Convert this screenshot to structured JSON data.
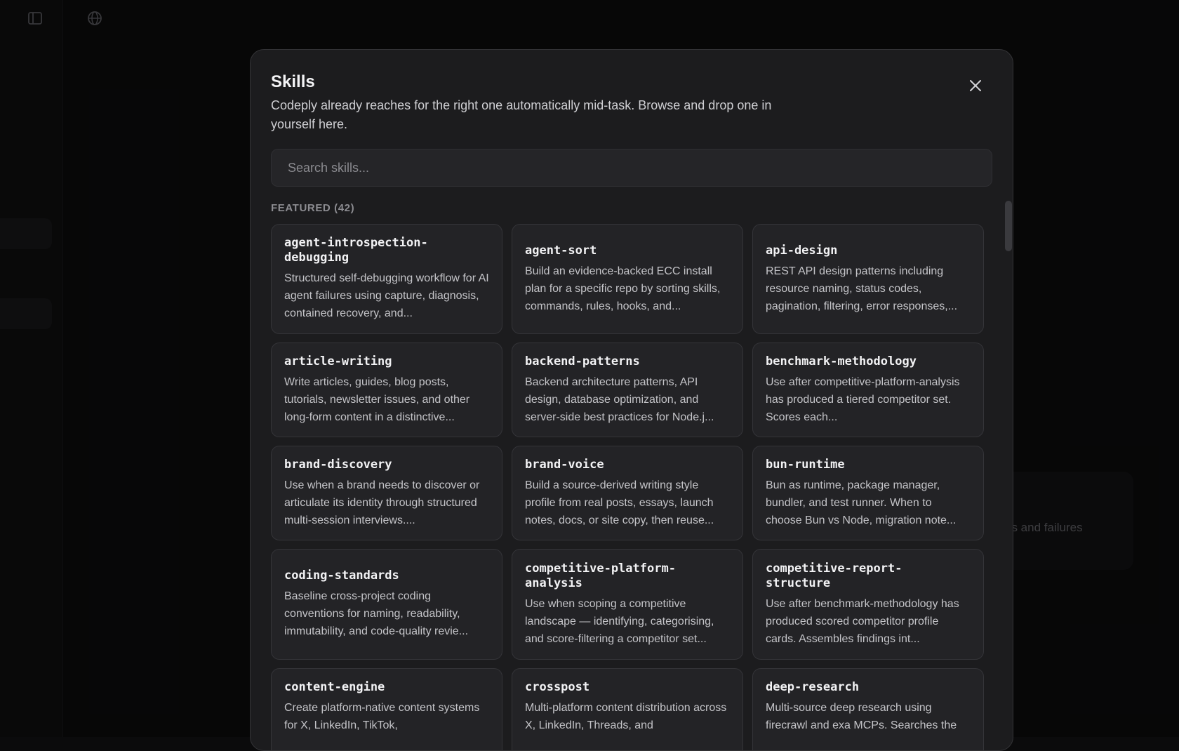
{
  "background": {
    "card_text": "es and failures",
    "icons": [
      "sidebar-toggle-icon",
      "globe-icon"
    ]
  },
  "modal": {
    "title": "Skills",
    "subtitle": "Codeply already reaches for the right one automatically mid-task. Browse and drop one in yourself here.",
    "search_placeholder": "Search skills...",
    "section_label": "FEATURED (42)"
  },
  "skills": [
    {
      "name": "agent-introspection-debugging",
      "name_display": "agent-introspection-\ndebugging",
      "description": "Structured self-debugging workflow for AI agent failures using capture, diagnosis, contained recovery, and..."
    },
    {
      "name": "agent-sort",
      "name_display": "agent-sort",
      "description": "Build an evidence-backed ECC install plan for a specific repo by sorting skills, commands, rules, hooks, and..."
    },
    {
      "name": "api-design",
      "name_display": "api-design",
      "description": "REST API design patterns including resource naming, status codes, pagination, filtering, error responses,..."
    },
    {
      "name": "article-writing",
      "name_display": "article-writing",
      "description": "Write articles, guides, blog posts, tutorials, newsletter issues, and other long-form content in a distinctive..."
    },
    {
      "name": "backend-patterns",
      "name_display": "backend-patterns",
      "description": "Backend architecture patterns, API design, database optimization, and server-side best practices for Node.j..."
    },
    {
      "name": "benchmark-methodology",
      "name_display": "benchmark-methodology",
      "description": "Use after competitive-platform-analysis has produced a tiered competitor set. Scores each..."
    },
    {
      "name": "brand-discovery",
      "name_display": "brand-discovery",
      "description": "Use when a brand needs to discover or articulate its identity through structured multi-session interviews...."
    },
    {
      "name": "brand-voice",
      "name_display": "brand-voice",
      "description": "Build a source-derived writing style profile from real posts, essays, launch notes, docs, or site copy, then reuse..."
    },
    {
      "name": "bun-runtime",
      "name_display": "bun-runtime",
      "description": "Bun as runtime, package manager, bundler, and test runner. When to choose Bun vs Node, migration note..."
    },
    {
      "name": "coding-standards",
      "name_display": "coding-standards",
      "description": "Baseline cross-project coding conventions for naming, readability, immutability, and code-quality revie..."
    },
    {
      "name": "competitive-platform-analysis",
      "name_display": "competitive-platform-\nanalysis",
      "description": "Use when scoping a competitive landscape — identifying, categorising, and score-filtering a competitor set..."
    },
    {
      "name": "competitive-report-structure",
      "name_display": "competitive-report-\nstructure",
      "description": "Use after benchmark-methodology has produced scored competitor profile cards. Assembles findings int..."
    },
    {
      "name": "content-engine",
      "name_display": "content-engine",
      "description": "Create platform-native content systems for X, LinkedIn, TikTok,"
    },
    {
      "name": "crosspost",
      "name_display": "crosspost",
      "description": "Multi-platform content distribution across X, LinkedIn, Threads, and"
    },
    {
      "name": "deep-research",
      "name_display": "deep-research",
      "description": "Multi-source deep research using firecrawl and exa MCPs. Searches the"
    }
  ]
}
